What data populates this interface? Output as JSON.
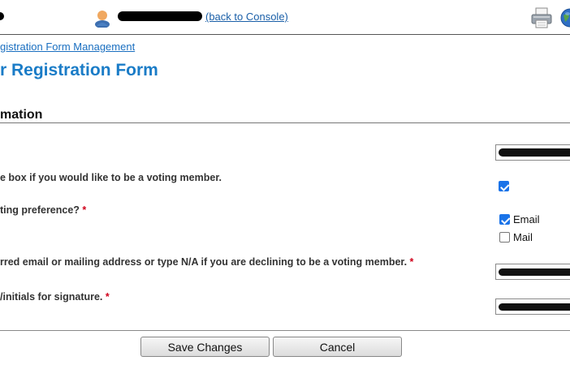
{
  "header": {
    "back_link": "(back to Console)"
  },
  "breadcrumb": "gistration Form Management",
  "page_title": "r Registration Form",
  "section_title": "mation",
  "questions": [
    {
      "label": "e box if you would like to be a voting member."
    },
    {
      "label": "ting preference?",
      "required_mark": "*"
    },
    {
      "label": "rred email or mailing address or type N/A if you are declining to be a voting member.",
      "required_mark": "*"
    },
    {
      "label": "/initials for signature.",
      "required_mark": "*"
    }
  ],
  "voting_options": [
    {
      "label": "Email",
      "checked": true
    },
    {
      "label": "Mail",
      "checked": false
    }
  ],
  "voting_member_checked": true,
  "buttons": {
    "save": "Save Changes",
    "cancel": "Cancel"
  },
  "icons": {
    "user": "user-avatar-icon",
    "print": "printer-icon",
    "globe": "globe-icon"
  },
  "colors": {
    "link": "#1a5fa8",
    "title": "#1a7cc7",
    "checkbox": "#1a73e8",
    "required": "#d0021b"
  }
}
